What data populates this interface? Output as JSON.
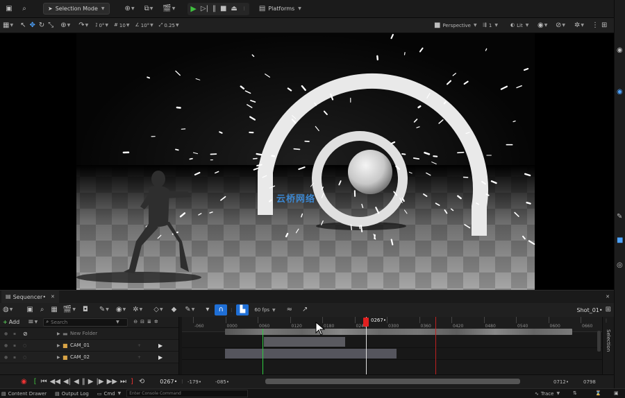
{
  "toolbar": {
    "selection_mode": "Selection Mode",
    "platforms": "Platforms"
  },
  "viewport_toolbar": {
    "rot_val": "0°",
    "scale_val": "10",
    "angle_val": "10°",
    "scale_snap": "0.25",
    "perspective": "Perspective",
    "camera_speed": "1",
    "lit": "Lit"
  },
  "watermark": "云桥网络",
  "sequencer": {
    "tab_label": "Sequencer•",
    "fps": "60 fps",
    "shot_name": "Shot_01•",
    "add_label": "Add",
    "search_placeholder": "Search",
    "playhead_label": "0267•",
    "tracks": [
      {
        "name": "New Folder"
      },
      {
        "name": "CAM_01"
      },
      {
        "name": "CAM_02"
      }
    ],
    "ruler_ticks": [
      "-060",
      "0000",
      "0060",
      "0120",
      "0180",
      "0240",
      "0300",
      "0360",
      "0420",
      "0480",
      "0540",
      "0600",
      "0660"
    ],
    "current_frame": "0267•",
    "range_start": "-179•",
    "view_start": "-085•",
    "view_end": "0712•",
    "range_end": "0798",
    "side_tab": "Selection"
  },
  "status_bar": {
    "content_drawer": "Content Drawer",
    "output_log": "Output Log",
    "cmd": "Cmd",
    "console_placeholder": "Enter Console Command",
    "trace": "Trace"
  },
  "colors": {
    "accent_blue": "#1f6fd6",
    "playhead_red": "#e02020",
    "play_green": "#3fbf3f",
    "marker_green": "#2ecc40"
  }
}
